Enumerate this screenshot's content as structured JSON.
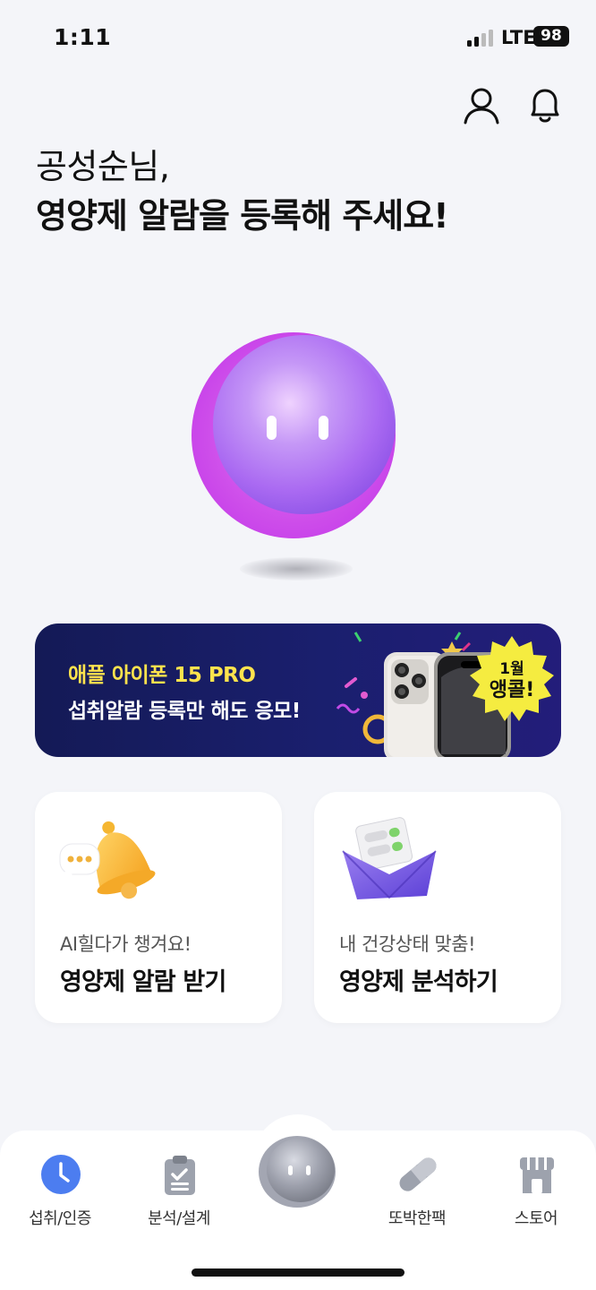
{
  "status_bar": {
    "time": "1:11",
    "network": "LTE",
    "battery": "98"
  },
  "header": {
    "profile_label": "profile",
    "notifications_label": "notifications"
  },
  "greeting": {
    "name": "공성순님,",
    "message": "영양제 알람을 등록해 주세요!"
  },
  "banner": {
    "line1": "애플 아이폰 15 PRO",
    "line2": "섭취알람 등록만 해도 응모!",
    "badge_line1": "1월",
    "badge_line2": "앵콜!"
  },
  "cards": [
    {
      "subtitle": "AI힐다가 챙겨요!",
      "title": "영양제 알람 받기",
      "icon": "bell-chat-icon"
    },
    {
      "subtitle": "내 건강상태 맞춤!",
      "title": "영양제 분석하기",
      "icon": "envelope-pills-icon"
    }
  ],
  "bottom_nav": {
    "items": [
      {
        "label": "섭취/인증",
        "icon": "clock-icon",
        "active": true
      },
      {
        "label": "분석/설계",
        "icon": "clipboard-icon",
        "active": false
      },
      {
        "label": "",
        "icon": "character-icon",
        "active": false
      },
      {
        "label": "또박한팩",
        "icon": "pill-icon",
        "active": false
      },
      {
        "label": "스토어",
        "icon": "store-icon",
        "active": false
      }
    ]
  },
  "colors": {
    "accent": "#4c7df0",
    "banner_bg": "#1a1f6e",
    "banner_yellow": "#ffe34d",
    "character": "#b95cf0"
  }
}
